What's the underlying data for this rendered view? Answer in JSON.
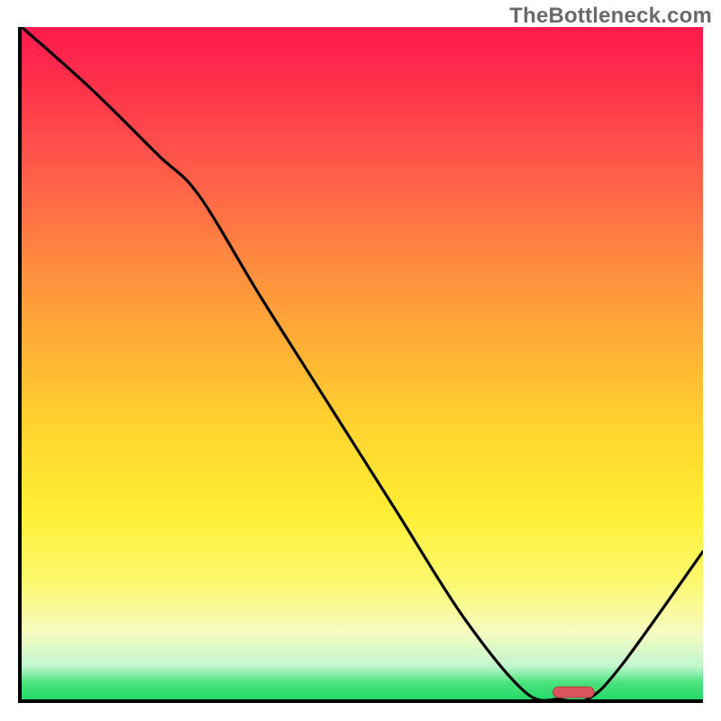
{
  "watermark": "TheBottleneck.com",
  "chart_data": {
    "type": "line",
    "title": "",
    "xlabel": "",
    "ylabel": "",
    "xlim": [
      0,
      100
    ],
    "ylim": [
      0,
      100
    ],
    "grid": false,
    "legend": false,
    "series": [
      {
        "name": "bottleneck-curve",
        "x": [
          0,
          10,
          20,
          26,
          35,
          45,
          55,
          65,
          74,
          79,
          83,
          88,
          100
        ],
        "y": [
          100,
          91,
          81,
          75,
          60,
          44,
          28,
          12,
          1,
          0,
          0,
          5,
          22
        ]
      }
    ],
    "marker": {
      "name": "optimum-marker",
      "x_center": 81,
      "width_pct": 6,
      "y": 0.5,
      "color": "#d8555e"
    },
    "background_gradient": {
      "top": "#ff1a4d",
      "mid": "#ffd52e",
      "bottom": "#24d96a"
    }
  }
}
